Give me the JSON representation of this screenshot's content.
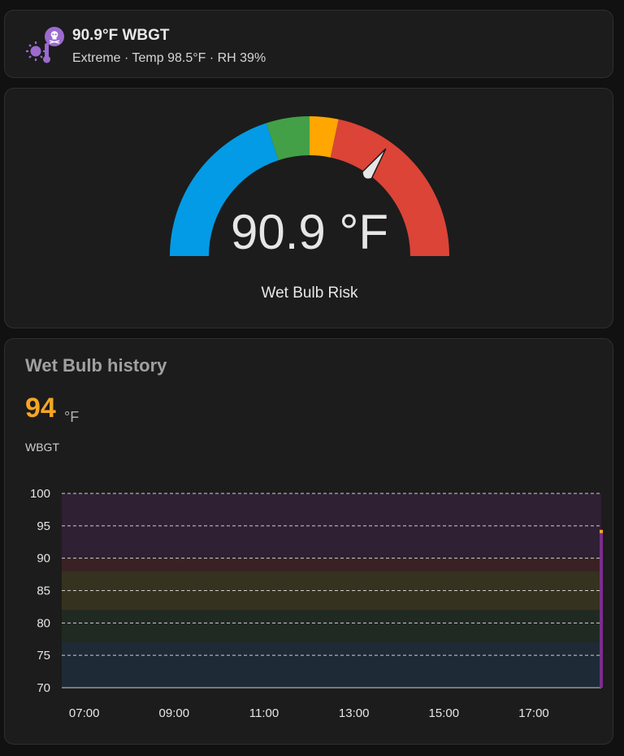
{
  "tile": {
    "name": "90.9°F WBGT",
    "state": "Extreme · Temp 98.5°F · RH 39%",
    "icon": "sun-thermometer-skull-icon",
    "icon_color": "#9c6ad0"
  },
  "gauge": {
    "value_text": "90.9 °F",
    "name": "Wet Bulb Risk",
    "value": 90.9,
    "min": 70,
    "max": 100,
    "segments": [
      {
        "from": 70,
        "to": 82,
        "color": "#039be5"
      },
      {
        "from": 82,
        "to": 85,
        "color": "#43a047"
      },
      {
        "from": 85,
        "to": 87,
        "color": "#ffa600"
      },
      {
        "from": 87,
        "to": 100,
        "color": "#db4437"
      }
    ]
  },
  "history": {
    "title": "Wet Bulb history",
    "current_value": "94",
    "unit": "°F",
    "entity_name": "WBGT",
    "accent_color": "#f5a623",
    "line_color": "#7b2d8e"
  },
  "chart_data": {
    "type": "line",
    "x": [
      "06:30",
      "18:30"
    ],
    "xticks": [
      "07:00",
      "09:00",
      "11:00",
      "13:00",
      "15:00",
      "17:00"
    ],
    "yticks": [
      70,
      75,
      80,
      85,
      90,
      95,
      100
    ],
    "ylim": [
      70,
      100
    ],
    "series": [
      {
        "x": [
          "18:30",
          "18:30"
        ],
        "values": [
          70,
          94
        ]
      }
    ],
    "bands": [
      {
        "from": 70,
        "to": 77,
        "color": "#1e2a36"
      },
      {
        "from": 77,
        "to": 82,
        "color": "#212a22"
      },
      {
        "from": 82,
        "to": 88,
        "color": "#35321f"
      },
      {
        "from": 88,
        "to": 90,
        "color": "#3a2224"
      },
      {
        "from": 90,
        "to": 100,
        "color": "#2f2033"
      }
    ],
    "grid": true
  }
}
